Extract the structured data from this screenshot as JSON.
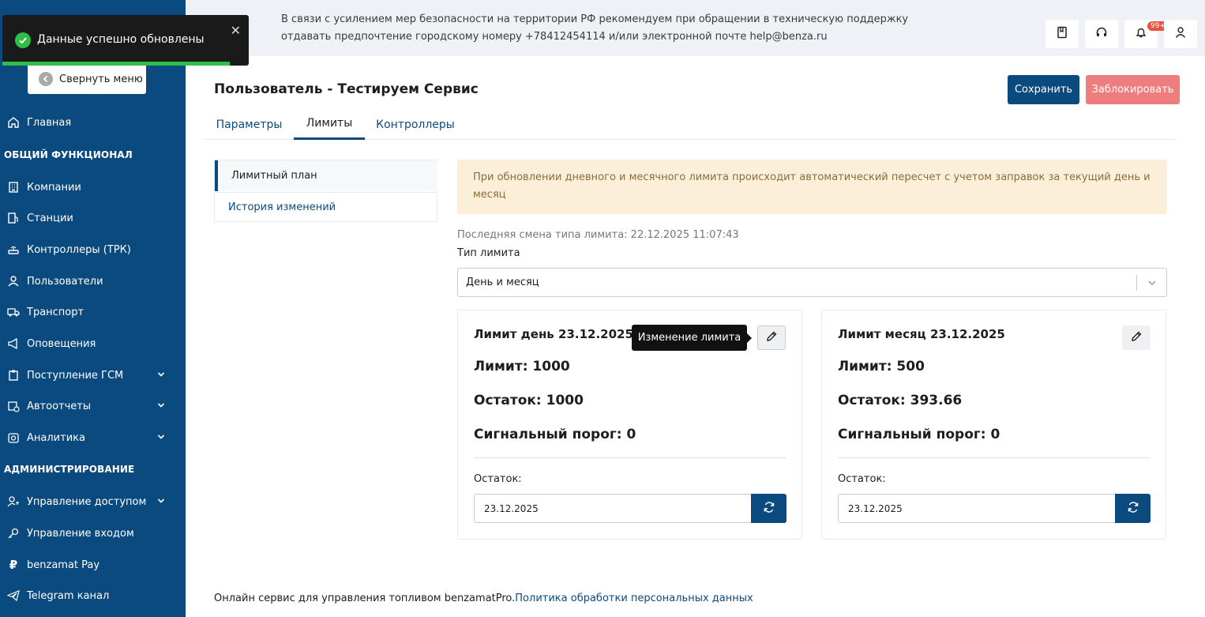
{
  "toast": {
    "message": "Данные успешно обновлены",
    "close": "✕"
  },
  "sidebar": {
    "collapse_label": "Свернуть меню",
    "items": [
      {
        "label": "Главная",
        "icon": "home-icon"
      },
      {
        "label": "Компании",
        "icon": "building-icon"
      },
      {
        "label": "Станции",
        "icon": "fuel-station-icon"
      },
      {
        "label": "Контроллеры (ТРК)",
        "icon": "router-icon"
      },
      {
        "label": "Пользователи",
        "icon": "user-icon"
      },
      {
        "label": "Транспорт",
        "icon": "truck-icon"
      },
      {
        "label": "Оповещения",
        "icon": "megaphone-icon"
      },
      {
        "label": "Поступление ГСМ",
        "icon": "clipboard-icon"
      },
      {
        "label": "Автоотчеты",
        "icon": "calendar-clock-icon"
      },
      {
        "label": "Аналитика",
        "icon": "analytics-icon"
      },
      {
        "label": "Управление доступом",
        "icon": "user-key-icon"
      },
      {
        "label": "Управление входом",
        "icon": "key-icon"
      },
      {
        "label": "benzamat Pay",
        "icon": "ruble-icon"
      },
      {
        "label": "Telegram канал",
        "icon": "telegram-icon"
      }
    ],
    "section_general": "ОБЩИЙ ФУНКЦИОНАЛ",
    "section_admin": "АДМИНИСТРИРОВАНИЕ"
  },
  "topbar": {
    "notice_line1": "В связи с усилением мер безопасности на территории РФ рекомендуем при обращении в техническую поддержку",
    "notice_line2": "отдавать предпочтение городскому номеру +78412454114 и/или электронной почте help@benza.ru",
    "notifications_badge": "99+"
  },
  "header": {
    "title": "Пользователь - Тестируем Сервис",
    "save_label": "Сохранить",
    "block_label": "Заблокировать"
  },
  "tabs": [
    {
      "label": "Параметры"
    },
    {
      "label": "Лимиты"
    },
    {
      "label": "Контроллеры"
    }
  ],
  "subnav": {
    "plan": "Лимитный план",
    "history": "История изменений"
  },
  "main": {
    "alert": "При обновлении дневного и месячного лимита происходит автоматический пересчет с учетом заправок за текущий день и месяц",
    "last_change": "Последняя смена типа лимита: 22.12.2025 11:07:43",
    "type_label": "Тип лимита",
    "type_value": "День и месяц"
  },
  "cards": [
    {
      "title": "Лимит день 23.12.2025",
      "limit": "Лимит: 1000",
      "remainder": "Остаток: 1000",
      "threshold": "Сигнальный порог: 0",
      "remainder_label": "Остаток:",
      "date": "23.12.2025"
    },
    {
      "title": "Лимит месяц 23.12.2025",
      "limit": "Лимит: 500",
      "remainder": "Остаток: 393.66",
      "threshold": "Сигнальный порог: 0",
      "remainder_label": "Остаток:",
      "date": "23.12.2025"
    }
  ],
  "tooltip": "Изменение лимита",
  "footer": {
    "text": "Онлайн сервис для управления топливом benzamatPro.",
    "link": "Политика обработки персональных данных"
  },
  "colors": {
    "primary": "#0b4a7e",
    "danger": "#f07d7d",
    "success": "#2fbf48",
    "warning_bg": "#fcefd9"
  }
}
